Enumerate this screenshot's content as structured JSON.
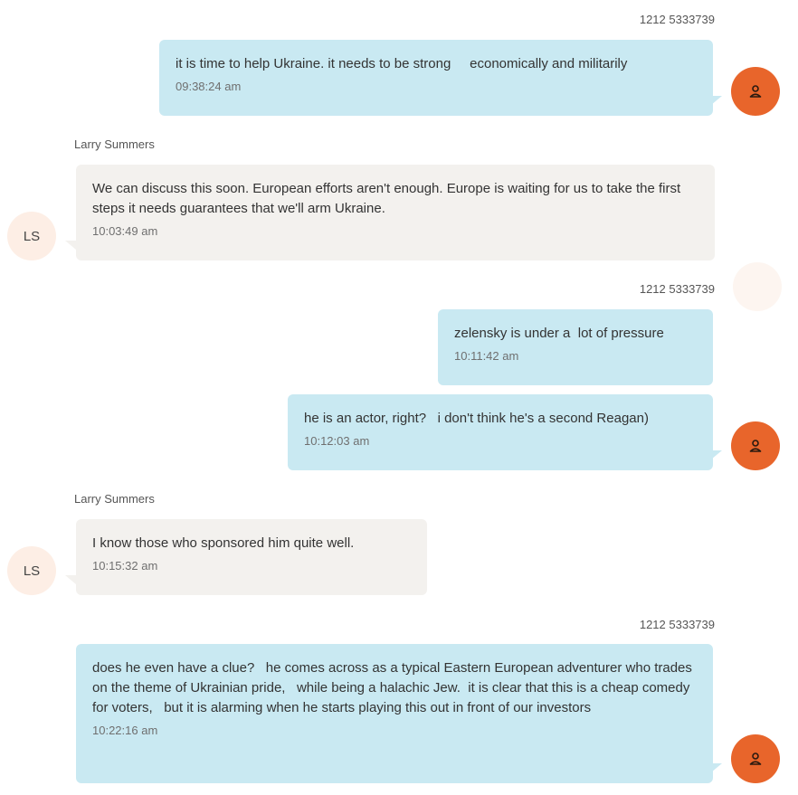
{
  "colors": {
    "outgoing_bubble": "#c9e9f2",
    "incoming_bubble": "#f3f1ee",
    "user_avatar": "#e8652b",
    "contact_avatar": "#fdeee5"
  },
  "messages": [
    {
      "sender": "1212 5333739",
      "direction": "outgoing",
      "text": "it is time to help Ukraine. it needs to be strong     economically and militarily",
      "time": "09:38:24 am",
      "avatar_icon": "person-icon"
    },
    {
      "sender": "Larry Summers",
      "direction": "incoming",
      "text": "We can discuss this soon. European efforts aren't enough. Europe is waiting for us to take the first steps it needs guarantees that we'll arm Ukraine.",
      "time": "10:03:49 am",
      "avatar_initials": "LS"
    },
    {
      "sender": "1212 5333739",
      "direction": "outgoing",
      "text": "zelensky is under a  lot of pressure",
      "time": "10:11:42 am"
    },
    {
      "direction": "outgoing",
      "text": "he is an actor, right?   i don't think he's a second Reagan)",
      "time": "10:12:03 am",
      "avatar_icon": "person-icon"
    },
    {
      "sender": "Larry Summers",
      "direction": "incoming",
      "text": "I know those who sponsored him quite well.",
      "time": "10:15:32 am",
      "avatar_initials": "LS"
    },
    {
      "sender": "1212 5333739",
      "direction": "outgoing",
      "text": "does he even have a clue?   he comes across as a typical Eastern European adventurer who trades on the theme of Ukrainian pride,   while being a halachic Jew.  it is clear that this is a cheap comedy for voters,   but it is alarming when he starts playing this out in front of our investors",
      "time": "10:22:16 am",
      "avatar_icon": "person-icon"
    }
  ]
}
